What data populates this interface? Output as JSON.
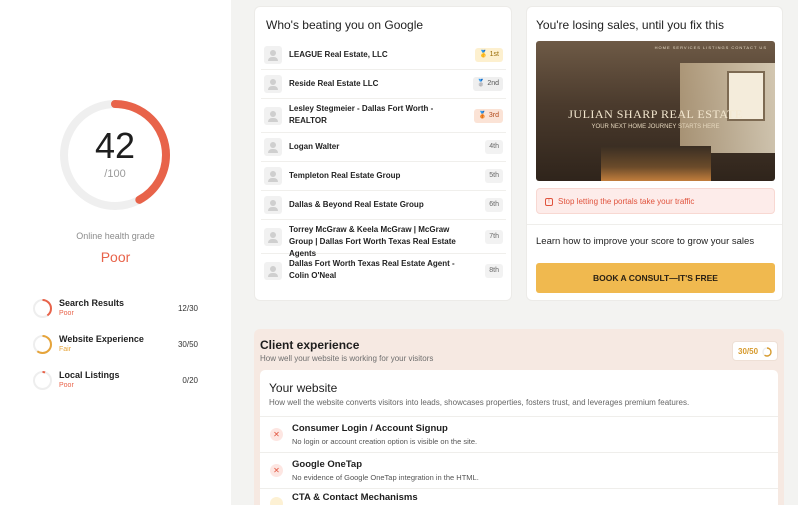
{
  "health": {
    "score": "42",
    "max": "/100",
    "value": 42,
    "grade_label": "Online health grade",
    "grade": "Poor",
    "accent_color": "#e8634a"
  },
  "categories": [
    {
      "name": "Search Results",
      "status": "Poor",
      "score": "12/30",
      "value": 12,
      "max": 30,
      "color": "#e8634a"
    },
    {
      "name": "Website Experience",
      "status": "Fair",
      "score": "30/50",
      "value": 30,
      "max": 50,
      "color": "#e6a43a"
    },
    {
      "name": "Local Listings",
      "status": "Poor",
      "score": "0/20",
      "value": 0,
      "max": 20,
      "color": "#e8634a"
    }
  ],
  "competitors": {
    "title": "Who's beating you on Google",
    "rows": [
      {
        "name": "LEAGUE Real Estate, LLC",
        "rank": "1st",
        "medal": "🥇"
      },
      {
        "name": "Reside Real Estate LLC",
        "rank": "2nd",
        "medal": "🥈"
      },
      {
        "name": "Lesley Stegmeier - Dallas Fort Worth - REALTOR",
        "rank": "3rd",
        "medal": "🥉"
      },
      {
        "name": "Logan Walter",
        "rank": "4th",
        "medal": ""
      },
      {
        "name": "Templeton Real Estate Group",
        "rank": "5th",
        "medal": ""
      },
      {
        "name": "Dallas & Beyond Real Estate Group",
        "rank": "6th",
        "medal": ""
      },
      {
        "name": "Torrey McGraw & Keela McGraw | McGraw Group | Dallas Fort Worth Texas Real Estate Agents",
        "rank": "7th",
        "medal": ""
      },
      {
        "name": "Dallas Fort Worth Texas Real Estate Agent - Colin O'Neal",
        "rank": "8th",
        "medal": ""
      }
    ]
  },
  "sales": {
    "title": "You're losing sales, until you fix this",
    "hero_nav": "HOME   SERVICES   LISTINGS   CONTACT US",
    "hero_brand": "JULIAN SHARP REAL ESTATE",
    "hero_tagline": "YOUR NEXT HOME JOURNEY STARTS HERE",
    "alert": "Stop letting the portals take your traffic",
    "learn": "Learn how to improve your score to grow your sales",
    "cta": "BOOK A CONSULT—IT'S FREE"
  },
  "client_experience": {
    "title": "Client experience",
    "subtitle": "How well your website is working for your visitors",
    "score": "30/50",
    "value": 30,
    "max": 50,
    "website": {
      "title": "Your website",
      "subtitle": "How well the website converts visitors into leads, showcases properties, fosters trust, and leverages premium features.",
      "items": [
        {
          "title": "Consumer Login / Account Signup",
          "desc": "No login or account creation option is visible on the site.",
          "status": "fail"
        },
        {
          "title": "Google OneTap",
          "desc": "No evidence of Google OneTap integration in the HTML.",
          "status": "fail"
        },
        {
          "title": "CTA & Contact Mechanisms",
          "desc": "",
          "status": "warn"
        }
      ]
    }
  }
}
